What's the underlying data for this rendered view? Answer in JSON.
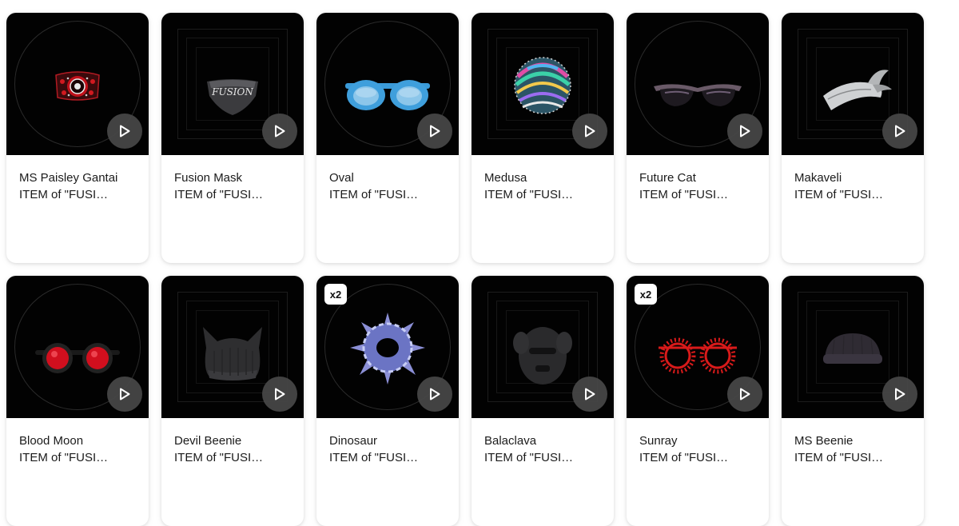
{
  "items": [
    {
      "name": "MS Paisley Gantai",
      "subtitle": "ITEM of \"FUSION\" collection",
      "badge": "",
      "art": "paisley-bandana"
    },
    {
      "name": "Fusion Mask",
      "subtitle": "ITEM of \"FUSION\" collection",
      "badge": "",
      "art": "fusion-mask"
    },
    {
      "name": "Oval",
      "subtitle": "ITEM of \"FUSION\" collection",
      "badge": "",
      "art": "oval-glasses"
    },
    {
      "name": "Medusa",
      "subtitle": "ITEM of \"FUSION\" collection",
      "badge": "",
      "art": "medusa-head"
    },
    {
      "name": "Future Cat",
      "subtitle": "ITEM of \"FUSION\" collection",
      "badge": "",
      "art": "cat-glasses"
    },
    {
      "name": "Makaveli",
      "subtitle": "ITEM of \"FUSION\" collection",
      "badge": "",
      "art": "bandana-knot"
    },
    {
      "name": "Blood Moon",
      "subtitle": "ITEM of \"FUSION\" collection",
      "badge": "",
      "art": "round-red-glasses"
    },
    {
      "name": "Devil Beenie",
      "subtitle": "ITEM of \"FUSION\" collection",
      "badge": "",
      "art": "devil-beanie"
    },
    {
      "name": "Dinosaur",
      "subtitle": "ITEM of \"FUSION\" collection",
      "badge": "x2",
      "art": "spiked-ring"
    },
    {
      "name": "Balaclava",
      "subtitle": "ITEM of \"FUSION\" collection",
      "badge": "",
      "art": "balaclava"
    },
    {
      "name": "Sunray",
      "subtitle": "ITEM of \"FUSION\" collection",
      "badge": "x2",
      "art": "sunray-glasses"
    },
    {
      "name": "MS Beenie",
      "subtitle": "ITEM of \"FUSION\" collection",
      "badge": "",
      "art": "beanie"
    }
  ],
  "colors": {
    "media_bg": "#020202",
    "play_button": "#484848",
    "text": "#1b1b1b"
  },
  "icons": {
    "play": "play-icon"
  }
}
